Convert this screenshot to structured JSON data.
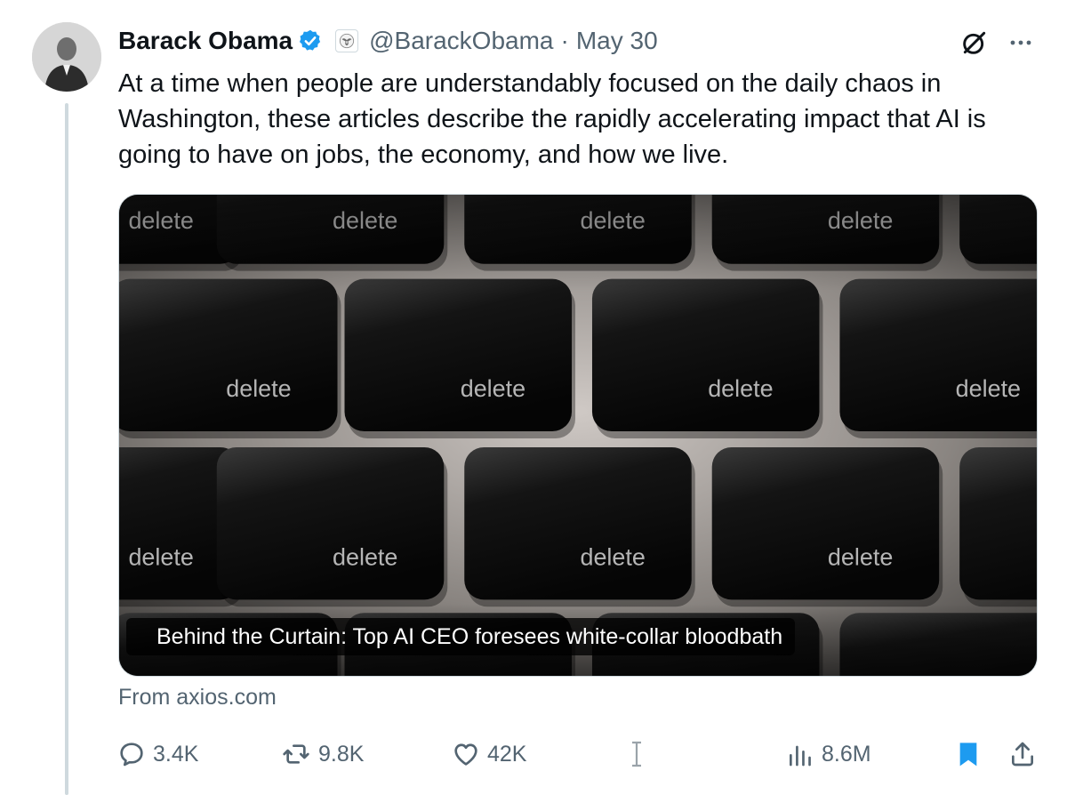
{
  "author": {
    "name": "Barack Obama",
    "handle": "@BarackObama",
    "separator": "·",
    "date": "May 30",
    "verified": true,
    "affiliation_badge": "us-seal-icon"
  },
  "tweet": {
    "text": "At a time when people are understandably focused on the daily chaos in Washington, these articles describe the rapidly accelerating impact that AI is going to have on jobs, the economy, and how we live."
  },
  "card": {
    "image_key_label": "delete",
    "caption": "Behind the Curtain: Top AI CEO foresees white-collar bloodbath",
    "source": "From axios.com"
  },
  "actions": {
    "replies": "3.4K",
    "reposts": "9.8K",
    "likes": "42K",
    "views": "8.6M"
  },
  "icons": {
    "verified": "verified-badge-icon",
    "grok": "grok-icon",
    "more": "more-options-icon",
    "reply": "reply-icon",
    "repost": "repost-icon",
    "like": "heart-icon",
    "views": "views-chart-icon",
    "bookmark": "bookmark-icon",
    "share": "share-icon"
  },
  "colors": {
    "accent": "#1d9bf0",
    "text_primary": "#0f1419",
    "text_secondary": "#536471",
    "thread_line": "#cfd9de"
  }
}
